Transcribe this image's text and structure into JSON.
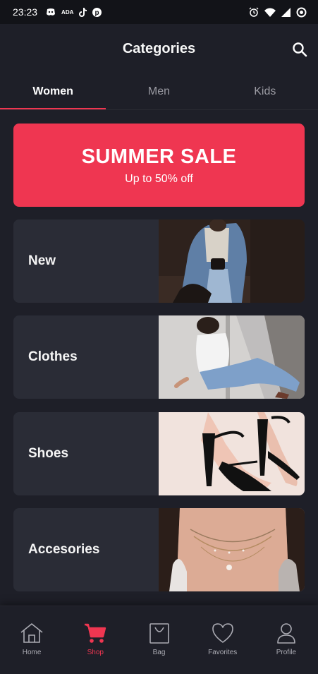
{
  "status_bar": {
    "time": "23:23",
    "notification_text": "ADA",
    "icons": [
      "discord-icon",
      "tiktok-icon",
      "pinterest-icon",
      "alarm-icon",
      "wifi-icon",
      "signal-icon",
      "sync-icon"
    ]
  },
  "header": {
    "title": "Categories",
    "search_icon": "search-icon"
  },
  "tabs": [
    {
      "label": "Women",
      "active": true
    },
    {
      "label": "Men",
      "active": false
    },
    {
      "label": "Kids",
      "active": false
    }
  ],
  "banner": {
    "title": "SUMMER SALE",
    "subtitle": "Up to 50% off"
  },
  "categories": [
    {
      "label": "New"
    },
    {
      "label": "Clothes"
    },
    {
      "label": "Shoes"
    },
    {
      "label": "Accesories"
    }
  ],
  "bottom_nav": [
    {
      "label": "Home",
      "icon": "home-icon",
      "active": false
    },
    {
      "label": "Shop",
      "icon": "cart-icon",
      "active": true
    },
    {
      "label": "Bag",
      "icon": "bag-icon",
      "active": false
    },
    {
      "label": "Favorites",
      "icon": "heart-icon",
      "active": false
    },
    {
      "label": "Profile",
      "icon": "profile-icon",
      "active": false
    }
  ],
  "colors": {
    "accent": "#ef3651",
    "background": "#1e1f28",
    "card": "#2a2c36",
    "inactive_text": "#ababb3"
  }
}
